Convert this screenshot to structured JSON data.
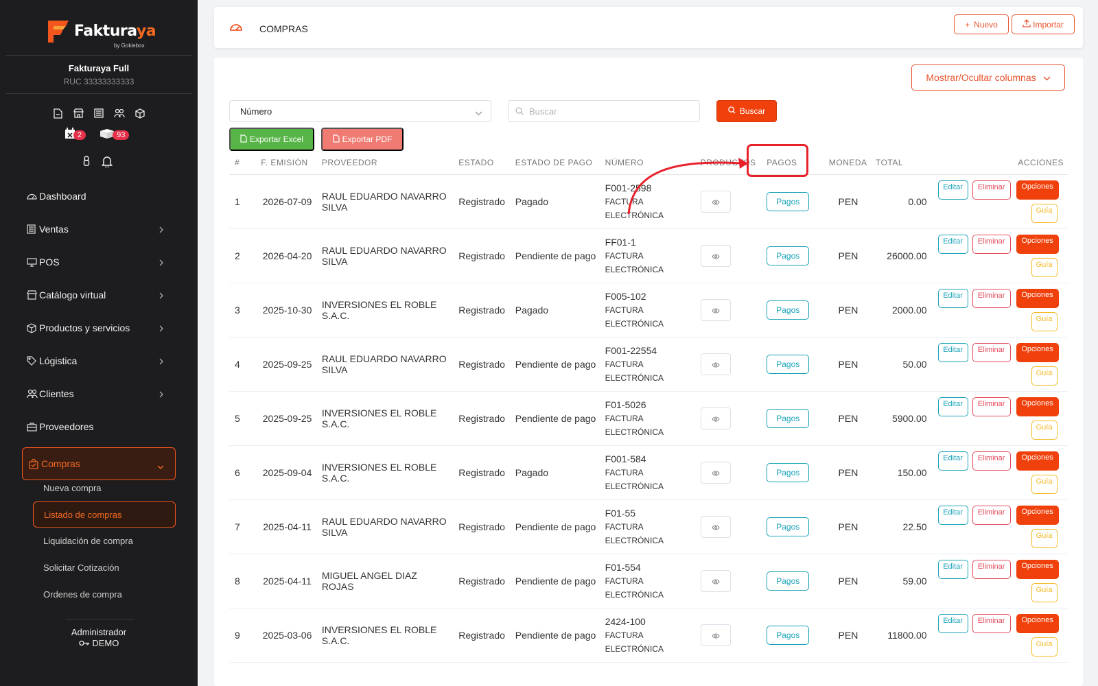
{
  "brand": {
    "name_main": "Faktura",
    "name_accent": "ya",
    "tagline": "by Gokiebox"
  },
  "company": {
    "name": "Fakturaya Full",
    "ruc": "RUC 33333333333"
  },
  "badges": {
    "calendar": "2",
    "boxes": "93"
  },
  "sidebar": {
    "items": [
      {
        "label": "Dashboard"
      },
      {
        "label": "Ventas"
      },
      {
        "label": "POS"
      },
      {
        "label": "Catálogo virtual"
      },
      {
        "label": "Productos y servicios"
      },
      {
        "label": "Lógistica"
      },
      {
        "label": "Clientes"
      },
      {
        "label": "Proveedores"
      },
      {
        "label": "Compras"
      }
    ],
    "subitems": [
      {
        "label": "Nueva compra"
      },
      {
        "label": "Listado de compras"
      },
      {
        "label": "Liquidación de compra"
      },
      {
        "label": "Solicitar Cotización"
      },
      {
        "label": "Ordenes de compra"
      }
    ]
  },
  "user": {
    "role": "Administrador",
    "name": "DEMO"
  },
  "header": {
    "title": "COMPRAS",
    "new_label": "Nuevo",
    "import_label": "Importar"
  },
  "toolbar": {
    "columns_label": "Mostrar/Ocultar columnas",
    "filter_select": "Número",
    "search_placeholder": "Buscar",
    "search_label": "Buscar",
    "excel_label": "Exportar Excel",
    "pdf_label": "Exportar PDF"
  },
  "table": {
    "headers": {
      "idx": "#",
      "date": "F. EMISIÓN",
      "provider": "PROVEEDOR",
      "status": "ESTADO",
      "payment_status": "ESTADO DE PAGO",
      "number": "NÚMERO",
      "products": "PRODUCTOS",
      "payments": "PAGOS",
      "currency": "MONEDA",
      "total": "TOTAL",
      "actions": "ACCIONES"
    },
    "buttons": {
      "pagos": "Pagos",
      "edit": "Editar",
      "delete": "Eliminar",
      "options": "Opciones",
      "guide": "Guía"
    },
    "rows": [
      {
        "idx": "1",
        "date": "2026-07-09",
        "provider": "RAUL EDUARDO NAVARRO SILVA",
        "status": "Registrado",
        "payment": "Pagado",
        "paid": true,
        "number": "F001-2598",
        "doc_type": "FACTURA ELECTRÓNICA",
        "currency": "PEN",
        "total": "0.00"
      },
      {
        "idx": "2",
        "date": "2026-04-20",
        "provider": "RAUL EDUARDO NAVARRO SILVA",
        "status": "Registrado",
        "payment": "Pendiente de pago",
        "paid": false,
        "number": "FF01-1",
        "doc_type": "FACTURA ELECTRÓNICA",
        "currency": "PEN",
        "total": "26000.00"
      },
      {
        "idx": "3",
        "date": "2025-10-30",
        "provider": "INVERSIONES EL ROBLE S.A.C.",
        "status": "Registrado",
        "payment": "Pagado",
        "paid": true,
        "number": "F005-102",
        "doc_type": "FACTURA ELECTRÓNICA",
        "currency": "PEN",
        "total": "2000.00"
      },
      {
        "idx": "4",
        "date": "2025-09-25",
        "provider": "RAUL EDUARDO NAVARRO SILVA",
        "status": "Registrado",
        "payment": "Pendiente de pago",
        "paid": false,
        "number": "F001-22554",
        "doc_type": "FACTURA ELECTRÓNICA",
        "currency": "PEN",
        "total": "50.00"
      },
      {
        "idx": "5",
        "date": "2025-09-25",
        "provider": "INVERSIONES EL ROBLE S.A.C.",
        "status": "Registrado",
        "payment": "Pendiente de pago",
        "paid": false,
        "number": "F01-5026",
        "doc_type": "FACTURA ELECTRÓNICA",
        "currency": "PEN",
        "total": "5900.00"
      },
      {
        "idx": "6",
        "date": "2025-09-04",
        "provider": "INVERSIONES EL ROBLE S.A.C.",
        "status": "Registrado",
        "payment": "Pagado",
        "paid": true,
        "number": "F001-584",
        "doc_type": "FACTURA ELECTRÓNICA",
        "currency": "PEN",
        "total": "150.00"
      },
      {
        "idx": "7",
        "date": "2025-04-11",
        "provider": "RAUL EDUARDO NAVARRO SILVA",
        "status": "Registrado",
        "payment": "Pendiente de pago",
        "paid": false,
        "number": "F01-55",
        "doc_type": "FACTURA ELECTRÓNICA",
        "currency": "PEN",
        "total": "22.50"
      },
      {
        "idx": "8",
        "date": "2025-04-11",
        "provider": "MIGUEL ANGEL DIAZ ROJAS",
        "status": "Registrado",
        "payment": "Pendiente de pago",
        "paid": false,
        "number": "F01-554",
        "doc_type": "FACTURA ELECTRÓNICA",
        "currency": "PEN",
        "total": "59.00"
      },
      {
        "idx": "9",
        "date": "2025-03-06",
        "provider": "INVERSIONES EL ROBLE S.A.C.",
        "status": "Registrado",
        "payment": "Pendiente de pago",
        "paid": false,
        "number": "2424-100",
        "doc_type": "FACTURA ELECTRÓNICA",
        "currency": "PEN",
        "total": "11800.00"
      }
    ]
  },
  "colors": {
    "accent": "#f0410c",
    "sidebar_bg": "#1d1d1f",
    "paid": "#4caf50",
    "pending": "#f5b921",
    "info": "#17a2b8",
    "danger": "#e34a5b",
    "annotation": "#e8202a"
  }
}
